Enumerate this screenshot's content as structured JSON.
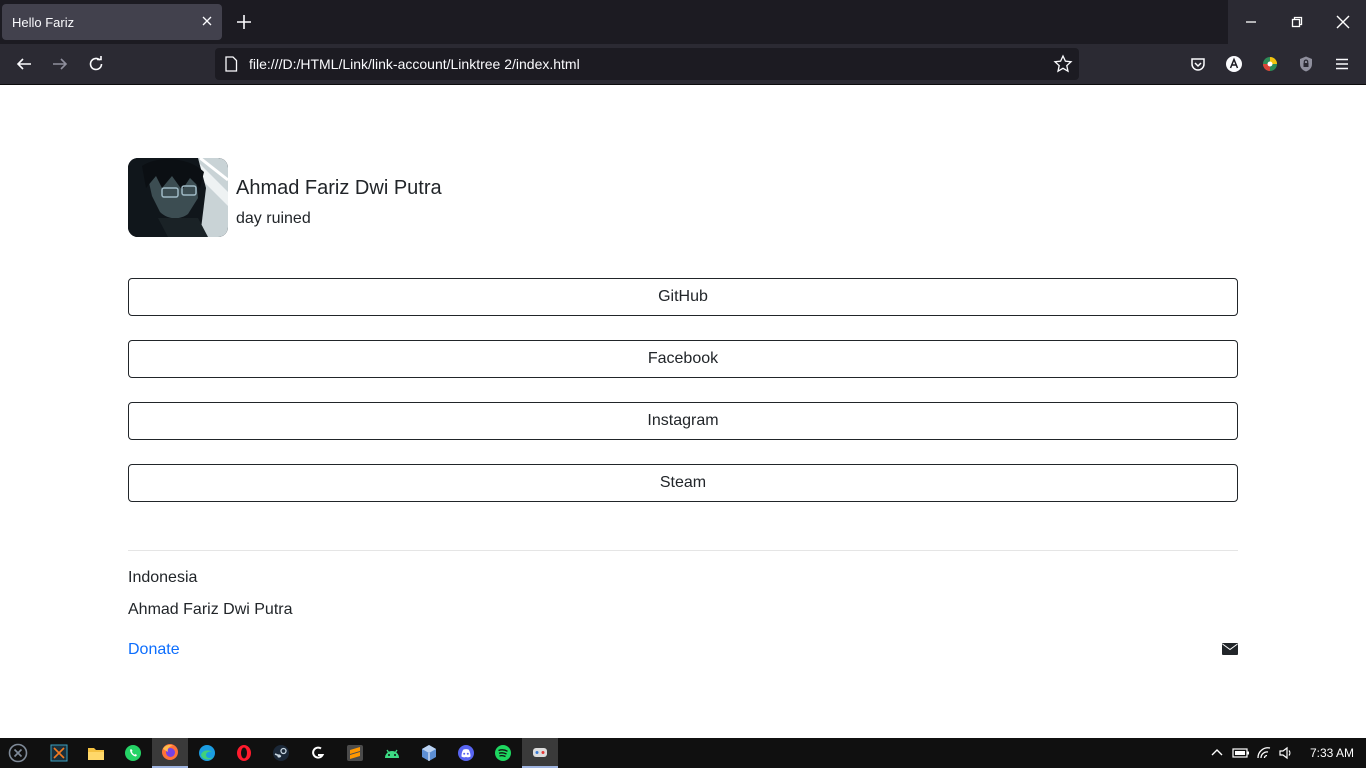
{
  "browser": {
    "tab_title": "Hello Fariz",
    "url": "file:///D:/HTML/Link/link-account/Linktree 2/index.html"
  },
  "profile": {
    "name": "Ahmad Fariz Dwi Putra",
    "bio": "day ruined"
  },
  "links": [
    {
      "label": "GitHub"
    },
    {
      "label": "Facebook"
    },
    {
      "label": "Instagram"
    },
    {
      "label": "Steam"
    }
  ],
  "footer": {
    "country": "Indonesia",
    "author": "Ahmad Fariz Dwi Putra",
    "donate_label": "Donate"
  },
  "taskbar": {
    "time": "7:33 AM",
    "apps": [
      "start-icon",
      "xampp-icon",
      "file-explorer-icon",
      "whatsapp-icon",
      "firefox-icon",
      "edge-icon",
      "opera-gx-icon",
      "steam-icon",
      "logitech-icon",
      "sublime-text-icon",
      "android-studio-icon",
      "virtualbox-icon",
      "discord-icon",
      "spotify-icon",
      "game-icon"
    ]
  },
  "colors": {
    "link_accent": "#0d6efd",
    "text": "#212529",
    "chrome_dark": "#1c1b22",
    "chrome_toolbar": "#2b2a33"
  }
}
